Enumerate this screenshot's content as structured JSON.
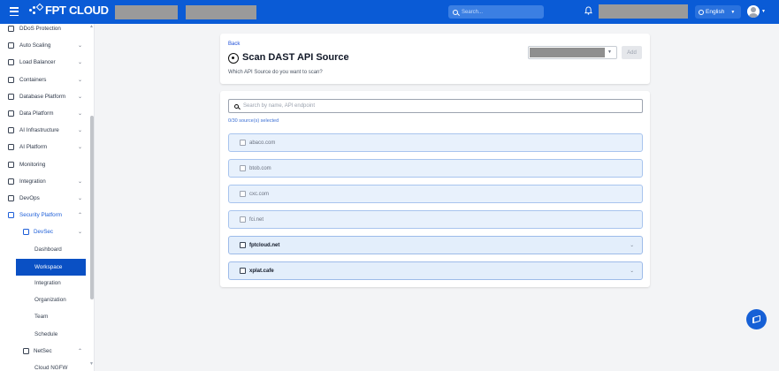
{
  "brand": {
    "name": "FPT CLOUD"
  },
  "topbar": {
    "search_placeholder": "Search...",
    "language": "English"
  },
  "sidebar": {
    "items": [
      {
        "label": "DDoS Protection",
        "icon": "shield-icon",
        "chevron": ""
      },
      {
        "label": "Auto Scaling",
        "icon": "scale-icon",
        "chevron": "⌄"
      },
      {
        "label": "Load Balancer",
        "icon": "balancer-icon",
        "chevron": "⌄"
      },
      {
        "label": "Containers",
        "icon": "container-icon",
        "chevron": "⌄"
      },
      {
        "label": "Database Platform",
        "icon": "database-icon",
        "chevron": "⌄"
      },
      {
        "label": "Data Platform",
        "icon": "data-icon",
        "chevron": "⌄"
      },
      {
        "label": "AI Infrastructure",
        "icon": "ai-infra-icon",
        "chevron": "⌄"
      },
      {
        "label": "AI Platform",
        "icon": "ai-platform-icon",
        "chevron": "⌄"
      },
      {
        "label": "Monitoring",
        "icon": "monitor-icon",
        "chevron": ""
      },
      {
        "label": "Integration",
        "icon": "integration-icon",
        "chevron": "⌄"
      },
      {
        "label": "DevOps",
        "icon": "devops-icon",
        "chevron": "⌄"
      },
      {
        "label": "Security Platform",
        "icon": "security-icon",
        "chevron": "⌃"
      }
    ],
    "devsec": {
      "label": "DevSec",
      "chevron": "⌄"
    },
    "devsec_children": [
      "Dashboard",
      "Workspace",
      "Integration",
      "Organization",
      "Team",
      "Schedule"
    ],
    "active_child": "Workspace",
    "netsec": {
      "label": "NetSec",
      "chevron": "⌃"
    },
    "netsec_children": [
      "Cloud NGFW"
    ]
  },
  "header": {
    "back_label": "Back",
    "title": "Scan DAST API Source",
    "subtitle": "Which API Source do you want to scan?",
    "add_button": "Add"
  },
  "content": {
    "filter_placeholder": "Search by name, API endpoint",
    "selected_text": "0/30 source(s) selected",
    "rows": [
      {
        "label": "abaco.com",
        "enabled": false
      },
      {
        "label": "btob.com",
        "enabled": false
      },
      {
        "label": "cxc.com",
        "enabled": false
      },
      {
        "label": "fci.net",
        "enabled": false
      },
      {
        "label": "fptcloud.net",
        "enabled": true
      },
      {
        "label": "xplat.cafe",
        "enabled": true
      }
    ]
  },
  "colors": {
    "topbar": "#0a5bd6",
    "active_item": "#0a50c4",
    "link": "#1d4ed8",
    "row_border": "#a8c4ee"
  }
}
